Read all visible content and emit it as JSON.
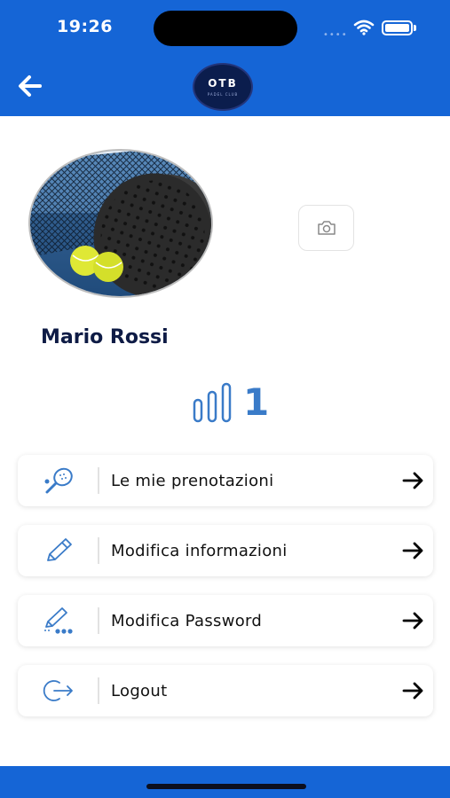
{
  "status_bar": {
    "time": "19:26",
    "signal": "••••"
  },
  "header": {
    "logo": {
      "main": "OTB",
      "sub": "PADEL CLUB"
    }
  },
  "profile": {
    "name": "Mario Rossi",
    "level_value": "1"
  },
  "menu": {
    "items": [
      {
        "label": "Le mie prenotazioni",
        "icon": "padel-racket-icon"
      },
      {
        "label": "Modifica informazioni",
        "icon": "pencil-icon"
      },
      {
        "label": "Modifica Password",
        "icon": "password-edit-icon"
      },
      {
        "label": "Logout",
        "icon": "logout-icon"
      }
    ]
  },
  "colors": {
    "primary": "#1565d6",
    "name_text": "#0e1b45",
    "accent_icon": "#3a7bc8"
  }
}
